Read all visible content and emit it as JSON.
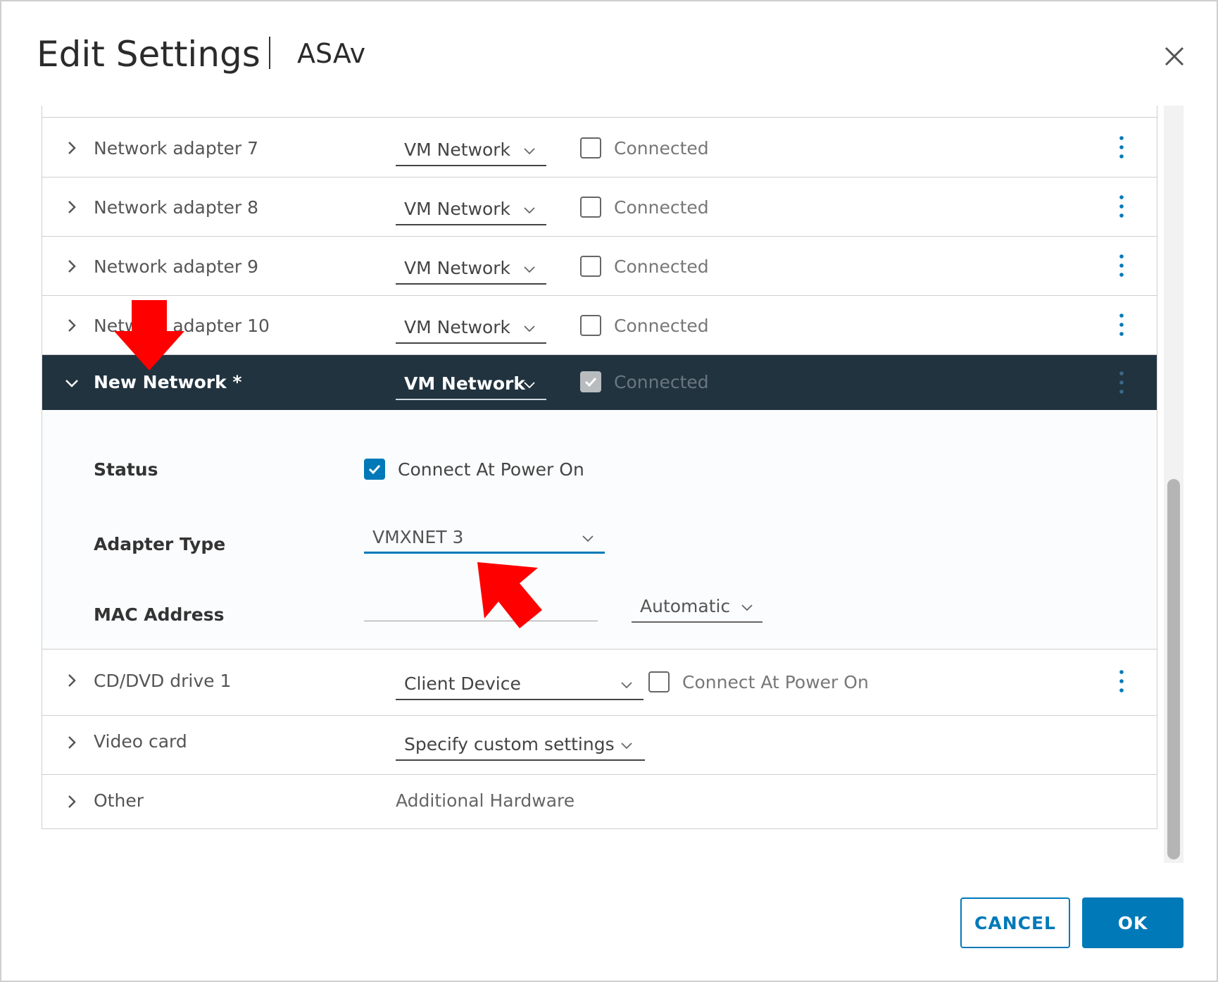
{
  "dialog": {
    "title": "Edit Settings",
    "subtitle": "ASAv"
  },
  "rows": [
    {
      "label": "Network adapter 7",
      "network": "VM Network",
      "connected_label": "Connected",
      "connected": false
    },
    {
      "label": "Network adapter 8",
      "network": "VM Network",
      "connected_label": "Connected",
      "connected": false
    },
    {
      "label": "Network adapter 9",
      "network": "VM Network",
      "connected_label": "Connected",
      "connected": false
    },
    {
      "label": "Network adapter 10",
      "network": "VM Network",
      "connected_label": "Connected",
      "connected": false
    }
  ],
  "new_network": {
    "label": "New Network *",
    "network": "VM Network",
    "connected_label": "Connected",
    "connected": true,
    "status_label": "Status",
    "status_checkbox_label": "Connect At Power On",
    "adapter_type_label": "Adapter Type",
    "adapter_type_value": "VMXNET 3",
    "mac_label": "MAC Address",
    "mac_value": "",
    "mac_mode": "Automatic"
  },
  "cd_dvd": {
    "label": "CD/DVD drive 1",
    "value": "Client Device",
    "checkbox_label": "Connect At Power On",
    "checked": false
  },
  "video_card": {
    "label": "Video card",
    "value": "Specify custom settings"
  },
  "other": {
    "label": "Other",
    "value": "Additional Hardware"
  },
  "buttons": {
    "cancel": "CANCEL",
    "ok": "OK"
  },
  "colors": {
    "accent": "#0079b8",
    "selected_row": "#21333f",
    "annotation_arrow": "#ff0000"
  }
}
